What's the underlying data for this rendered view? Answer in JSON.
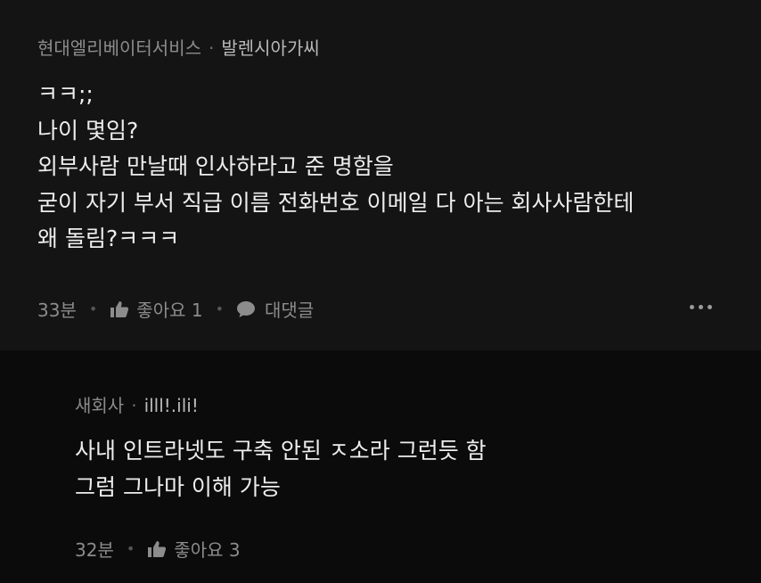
{
  "comment": {
    "company": "현대엘리베이터서비스",
    "separator": "·",
    "nickname": "발렌시아가씨",
    "lines": [
      "ㅋㅋ;;",
      "나이 몇임?",
      "외부사람 만날때 인사하라고 준 명함을",
      "굳이 자기 부서 직급 이름 전화번호 이메일 다 아는 회사사람한테",
      "왜 돌림?ㅋㅋㅋ"
    ],
    "time": "33분",
    "like_label": "좋아요 1",
    "reply_label": "대댓글"
  },
  "reply": {
    "company": "새회사",
    "separator": "·",
    "nickname": "illl!.ili!",
    "lines": [
      "사내 인트라넷도 구축 안된 ㅈ소라 그런듯 함",
      "그럼 그나마 이해 가능"
    ],
    "time": "32분",
    "like_label": "좋아요 3"
  },
  "icons": {
    "like": "thumbs-up-icon",
    "reply": "speech-bubble-icon",
    "more": "more-dots-icon"
  }
}
